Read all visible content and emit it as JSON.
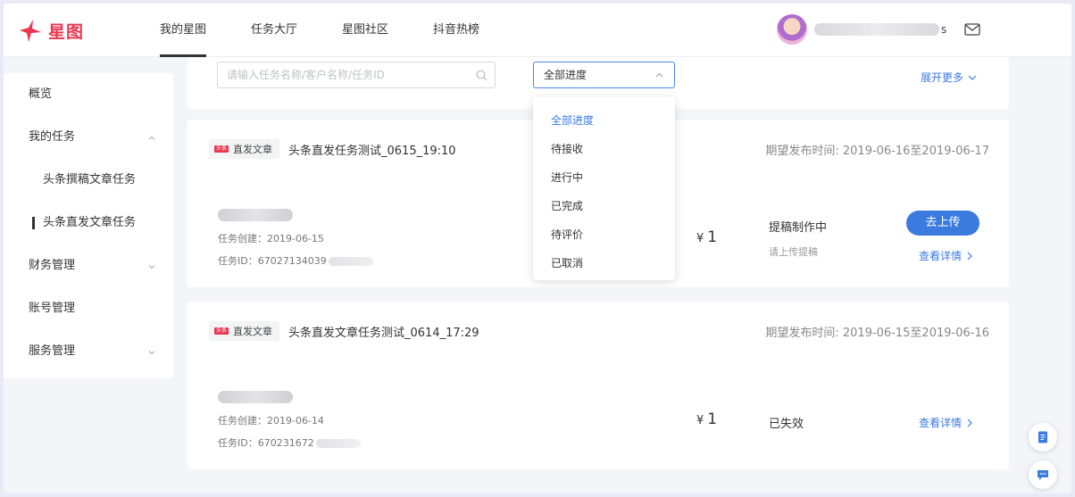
{
  "brand": {
    "name": "星图",
    "accent": "#e8374f",
    "link_color": "#3b7be0"
  },
  "nav": {
    "items": [
      "我的星图",
      "任务大厅",
      "星图社区",
      "抖音热榜"
    ],
    "active": "我的星图"
  },
  "user": {
    "name_suffix": "s"
  },
  "sidebar": {
    "items": [
      {
        "label": "概览"
      },
      {
        "label": "我的任务"
      },
      {
        "label": "头条撰稿文章任务"
      },
      {
        "label": "头条直发文章任务"
      },
      {
        "label": "财务管理"
      },
      {
        "label": "账号管理"
      },
      {
        "label": "服务管理"
      }
    ]
  },
  "filter": {
    "search_placeholder": "请输入任务名称/客户名称/任务ID",
    "select_value": "全部进度",
    "expand_label": "展开更多"
  },
  "dropdown": {
    "options": [
      "全部进度",
      "待接收",
      "进行中",
      "已完成",
      "待评价",
      "已取消"
    ],
    "selected": "全部进度"
  },
  "tasks": [
    {
      "tag_mini": "头条",
      "tag": "直发文章",
      "title": "头条直发任务测试_0615_19:10",
      "expect": "期望发布时间: 2019-06-16至2019-06-17",
      "created": "任务创建：2019-06-15",
      "task_id": "任务ID：67027134039",
      "currency": "¥",
      "price": "1",
      "status": "提稿制作中",
      "hint": "请上传提稿",
      "action_label": "去上传",
      "detail_label": "查看详情"
    },
    {
      "tag_mini": "头条",
      "tag": "直发文章",
      "title": "头条直发文章任务测试_0614_17:29",
      "expect": "期望发布时间: 2019-06-15至2019-06-16",
      "created": "任务创建：2019-06-14",
      "task_id": "任务ID：670231672",
      "currency": "¥",
      "price": "1",
      "status": "已失效",
      "detail_label": "查看详情"
    }
  ]
}
